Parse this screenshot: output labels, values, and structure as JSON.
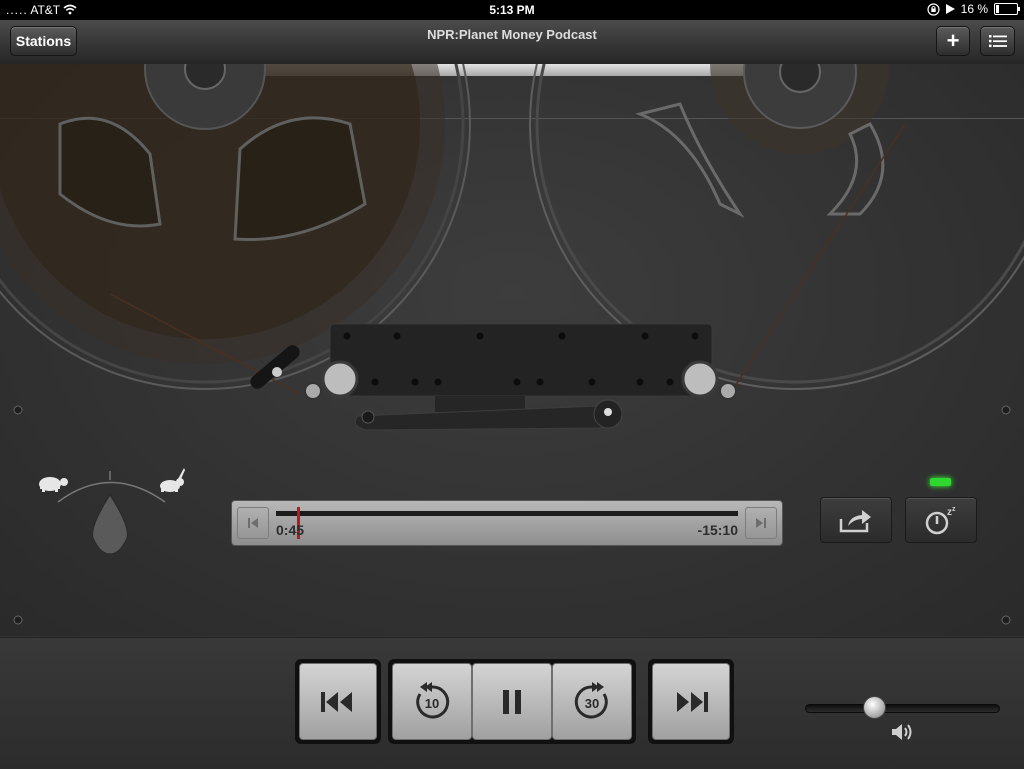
{
  "status_bar": {
    "carrier": "AT&T",
    "time": "5:13 PM",
    "battery": "16 %",
    "battery_fraction": 0.16
  },
  "nav": {
    "title": "NPR:Planet Money Podcast",
    "stations_label": "Stations",
    "add_label": "+"
  },
  "player": {
    "elapsed": "0:45",
    "remaining": "-15:10",
    "progress_fraction": 0.047,
    "rewind_seconds": "10",
    "forward_seconds": "30",
    "volume_fraction": 0.34,
    "sleep_timer_active": true
  },
  "colors": {
    "progress_marker": "#c0151a",
    "sleep_indicator": "#2fd82f"
  },
  "icons": {
    "nav": [
      "add-icon",
      "list-icon"
    ],
    "speed": [
      "turtle-icon",
      "rabbit-icon"
    ],
    "transport": [
      "skip-previous-icon",
      "rewind-10-icon",
      "pause-icon",
      "forward-30-icon",
      "skip-next-icon"
    ],
    "extras": [
      "share-icon",
      "sleep-timer-icon",
      "speaker-icon"
    ]
  }
}
